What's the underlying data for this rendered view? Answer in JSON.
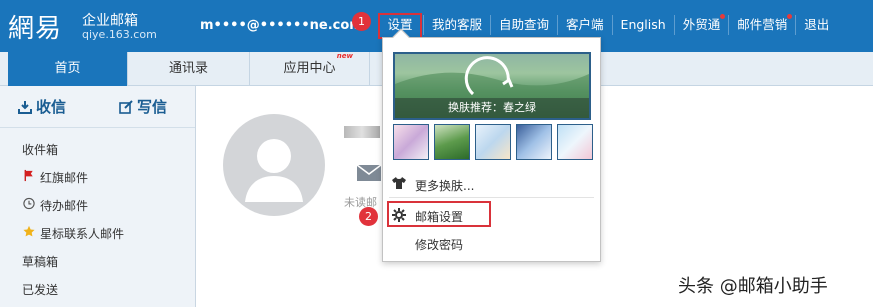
{
  "header": {
    "logo_mark": "網易",
    "logo_title": "企业邮箱",
    "logo_domain": "qiye.163.com",
    "account_email": "m••••@••••••ne.com",
    "nav": [
      {
        "label": "设置",
        "step": "1"
      },
      {
        "label": "我的客服"
      },
      {
        "label": "自助查询"
      },
      {
        "label": "客户端"
      },
      {
        "label": "English"
      },
      {
        "label": "外贸通",
        "dot": true
      },
      {
        "label": "邮件营销",
        "dot": true
      },
      {
        "label": "退出"
      }
    ]
  },
  "tabs": [
    {
      "label": "首页",
      "active": true
    },
    {
      "label": "通讯录"
    },
    {
      "label": "应用中心",
      "tag": "new"
    }
  ],
  "sidebar": {
    "receive_label": "收信",
    "compose_label": "写信",
    "folders": [
      {
        "label": "收件箱"
      },
      {
        "label": "红旗邮件",
        "icon": "red-flag-icon"
      },
      {
        "label": "待办邮件",
        "icon": "clock-icon"
      },
      {
        "label": "星标联系人邮件",
        "icon": "star-icon"
      },
      {
        "label": "草稿箱"
      },
      {
        "label": "已发送"
      }
    ]
  },
  "main": {
    "unread_label": "未读邮"
  },
  "dropdown": {
    "skin_recommend": "换肤推荐：春之绿",
    "more_skins": "更多换肤...",
    "mailbox_settings": "邮箱设置",
    "mailbox_settings_step": "2",
    "change_password": "修改密码"
  },
  "watermark": "头条 @邮箱小助手",
  "colors": {
    "brand_blue": "#1a75bb",
    "highlight_red": "#d9323a",
    "sidebar_bg": "#eef3f8"
  }
}
